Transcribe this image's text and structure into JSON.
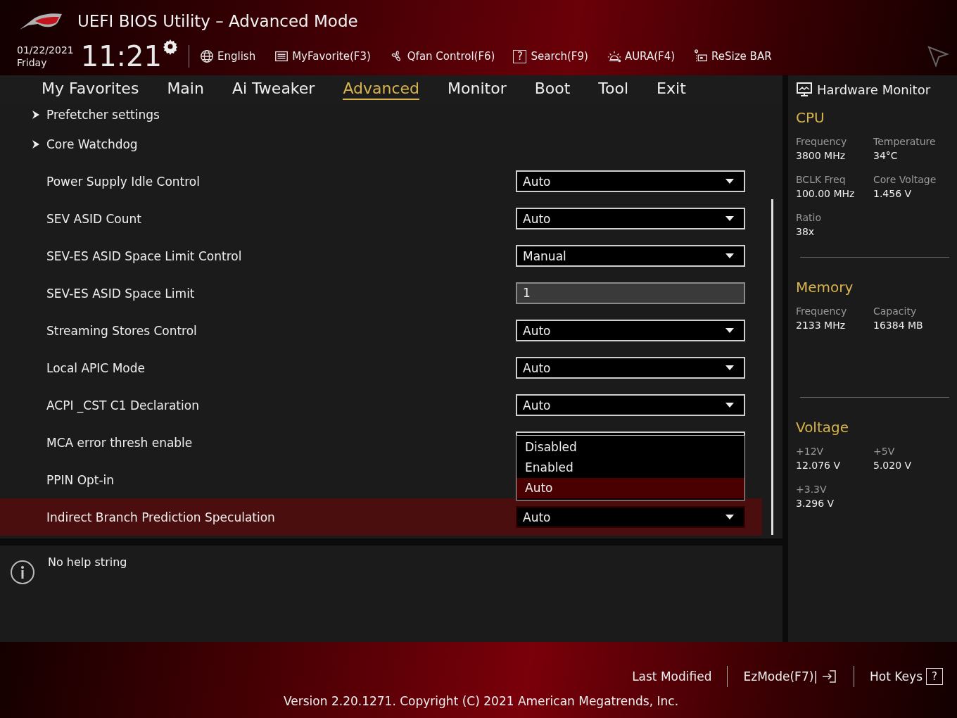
{
  "window": {
    "title": "UEFI BIOS Utility – Advanced Mode"
  },
  "clock": {
    "date": "01/22/2021",
    "day": "Friday",
    "time": "11:21"
  },
  "toolbar": [
    {
      "label": "English"
    },
    {
      "label": "MyFavorite(F3)"
    },
    {
      "label": "Qfan Control(F6)"
    },
    {
      "label": "Search(F9)",
      "key": "?"
    },
    {
      "label": "AURA(F4)"
    },
    {
      "label": "ReSize BAR"
    }
  ],
  "tabs": [
    {
      "label": "My Favorites",
      "selected": false
    },
    {
      "label": "Main",
      "selected": false
    },
    {
      "label": "Ai Tweaker",
      "selected": false
    },
    {
      "label": "Advanced",
      "selected": true
    },
    {
      "label": "Monitor",
      "selected": false
    },
    {
      "label": "Boot",
      "selected": false
    },
    {
      "label": "Tool",
      "selected": false
    },
    {
      "label": "Exit",
      "selected": false
    }
  ],
  "settings": [
    {
      "label": "Prefetcher settings",
      "kind": "submenu",
      "selected": false
    },
    {
      "label": "Core Watchdog",
      "kind": "submenu",
      "selected": false
    },
    {
      "label": "Power Supply Idle Control",
      "kind": "dropdown",
      "value": "Auto",
      "selected": false
    },
    {
      "label": "SEV ASID Count",
      "kind": "dropdown",
      "value": "Auto",
      "selected": false
    },
    {
      "label": "SEV-ES ASID Space Limit Control",
      "kind": "dropdown",
      "value": "Manual",
      "selected": false
    },
    {
      "label": "SEV-ES ASID Space Limit",
      "kind": "input",
      "value": "1",
      "selected": false
    },
    {
      "label": "Streaming Stores Control",
      "kind": "dropdown",
      "value": "Auto",
      "selected": false
    },
    {
      "label": "Local APIC Mode",
      "kind": "dropdown",
      "value": "Auto",
      "selected": false
    },
    {
      "label": "ACPI _CST C1 Declaration",
      "kind": "dropdown",
      "value": "Auto",
      "selected": false
    },
    {
      "label": "MCA error thresh enable",
      "kind": "dropdown",
      "selected": false,
      "open": true,
      "options": [
        {
          "label": "Disabled",
          "selected": false
        },
        {
          "label": "Enabled",
          "selected": false
        },
        {
          "label": "Auto",
          "selected": true
        }
      ]
    },
    {
      "label": "PPIN Opt-in",
      "kind": "hidden",
      "selected": false
    },
    {
      "label": "Indirect Branch Prediction Speculation",
      "kind": "dropdown",
      "value": "Auto",
      "selected": true
    }
  ],
  "help": {
    "text": "No help string"
  },
  "hardware_monitor": {
    "title": "Hardware Monitor",
    "sections": [
      {
        "title": "CPU",
        "stats": [
          {
            "label": "Frequency",
            "value": "3800 MHz"
          },
          {
            "label": "Temperature",
            "value": "34°C"
          },
          {
            "label": "BCLK Freq",
            "value": "100.00 MHz"
          },
          {
            "label": "Core Voltage",
            "value": "1.456 V"
          },
          {
            "label": "Ratio",
            "value": "38x"
          }
        ]
      },
      {
        "title": "Memory",
        "stats": [
          {
            "label": "Frequency",
            "value": "2133 MHz"
          },
          {
            "label": "Capacity",
            "value": "16384 MB"
          }
        ]
      },
      {
        "title": "Voltage",
        "stats": [
          {
            "label": "+12V",
            "value": "12.076 V"
          },
          {
            "label": "+5V",
            "value": "5.020 V"
          },
          {
            "label": "+3.3V",
            "value": "3.296 V"
          }
        ]
      }
    ]
  },
  "footer": {
    "actions": [
      {
        "label": "Last Modified"
      },
      {
        "label": "EzMode(F7)|"
      },
      {
        "label": "Hot Keys",
        "key": "?"
      }
    ],
    "version": "Version 2.20.1271. Copyright (C) 2021 American Megatrends, Inc."
  }
}
